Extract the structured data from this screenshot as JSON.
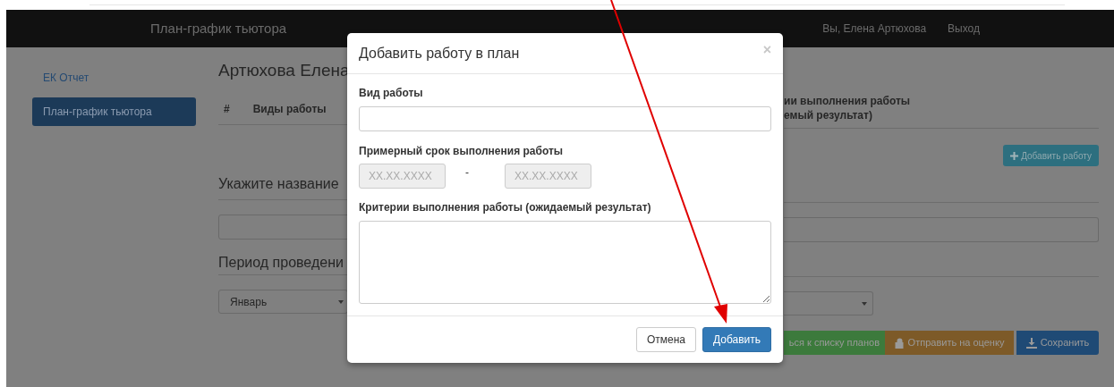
{
  "navbar": {
    "title": "План-график тьютора",
    "user": "Вы, Елена Артюхова",
    "logout": "Выход"
  },
  "sidebar": {
    "items": [
      {
        "label": "ЕК Отчет",
        "selected": false
      },
      {
        "label": "План-график тьютора",
        "selected": true
      }
    ]
  },
  "page": {
    "heading": "Артюхова Елена",
    "table_columns": [
      "#",
      "Виды работы"
    ],
    "table_column_right": [
      "ии выполнения работы",
      "емый результат)"
    ],
    "add_work_button": "Добавить работу",
    "name_heading": "Укажите название",
    "period_heading": "Период проведени",
    "month_select": "Январь",
    "actions": [
      {
        "label": "ься к списку планов",
        "kind": "back"
      },
      {
        "label": "Отправить на оценку",
        "kind": "submit"
      },
      {
        "label": "Сохранить",
        "kind": "save"
      }
    ]
  },
  "dialog": {
    "title": "Добавить работу в план",
    "close": "×",
    "work_type_label": "Вид работы",
    "term_label": "Примерный срок выполнения работы",
    "date_from": {
      "placeholder": "XX.XX.XXXX"
    },
    "separator": "-",
    "date_to": {
      "placeholder": "XX.XX.XXXX"
    },
    "criteria_label": "Критерии выполнения работы (ожидаемый результат)",
    "buttons": [
      {
        "label": "Отмена",
        "kind": "default"
      },
      {
        "label": "Добавить",
        "kind": "primary"
      }
    ]
  }
}
